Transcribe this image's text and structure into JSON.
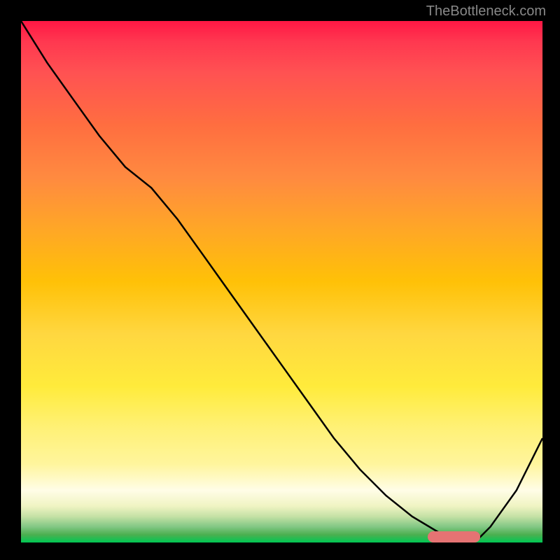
{
  "watermark": "TheBottleneck.com",
  "chart_data": {
    "type": "line",
    "title": "",
    "xlabel": "",
    "ylabel": "",
    "x": [
      0,
      5,
      10,
      15,
      20,
      25,
      30,
      35,
      40,
      45,
      50,
      55,
      60,
      65,
      70,
      75,
      80,
      82,
      84,
      86,
      88,
      90,
      95,
      100
    ],
    "values": [
      100,
      92,
      85,
      78,
      72,
      68,
      62,
      55,
      48,
      41,
      34,
      27,
      20,
      14,
      9,
      5,
      2,
      1,
      0.5,
      0.5,
      1,
      3,
      10,
      20
    ],
    "optimal_marker_range": [
      78,
      88
    ],
    "ylim": [
      0,
      100
    ],
    "xlim": [
      0,
      100
    ]
  }
}
